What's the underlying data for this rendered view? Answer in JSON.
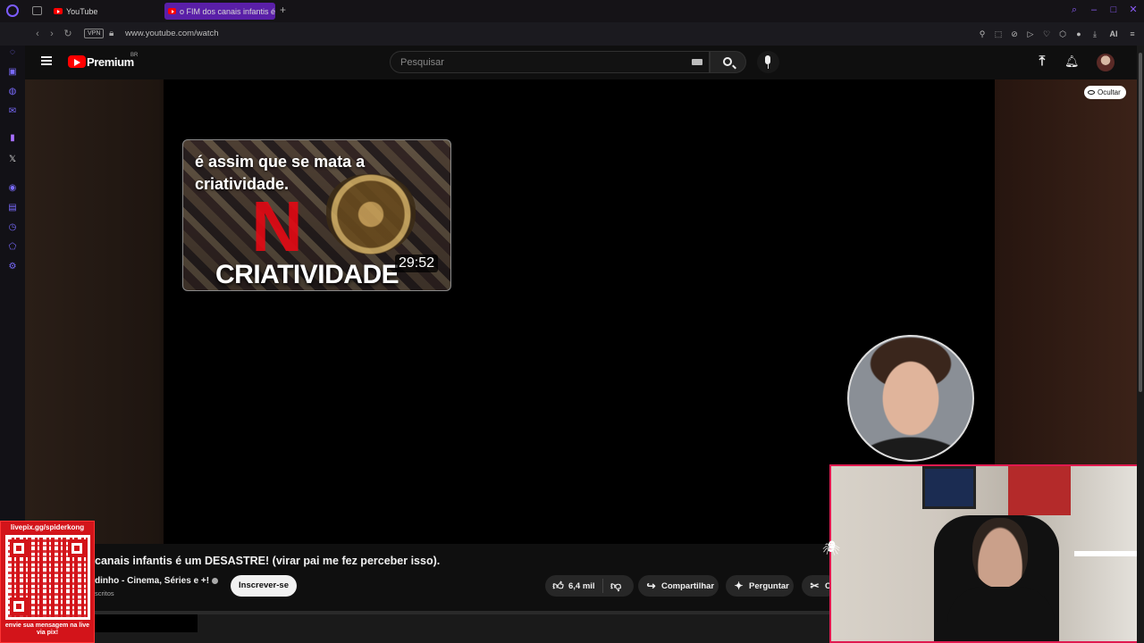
{
  "browser": {
    "tabs": [
      {
        "label": "YouTube"
      },
      {
        "label": "o FIM dos canais infantis é"
      }
    ],
    "url": "www.youtube.com/watch",
    "vpn_label": "VPN",
    "ai_label": "AI"
  },
  "youtube": {
    "brand": "Premium",
    "region": "BR",
    "search_placeholder": "Pesquisar"
  },
  "video": {
    "hide_label": "Ocultar",
    "endcard": {
      "overlay_text": "é assim que se mata a criatividade.",
      "thumbnail_word": "CRIATIVIDADE",
      "duration": "29:52"
    },
    "title": "canais infantis é um DESASTRE! (virar pai me fez perceber isso).",
    "channel": "dinho - Cinema, Séries e +!",
    "subscribers": "scritos",
    "subscribe_label": "Inscrever-se",
    "likes": "6,4 mil",
    "share_label": "Compartilhar",
    "ask_label": "Perguntar",
    "clip_label": "C"
  },
  "overlay": {
    "qr_top": "livepix.gg/spiderkong",
    "qr_bottom": "envie sua mensagem na live via pix!"
  },
  "colors": {
    "accent": "#7c5cff",
    "youtube_red": "#ff0000",
    "qr_red": "#d3141a",
    "cam_border": "#e0194f"
  }
}
